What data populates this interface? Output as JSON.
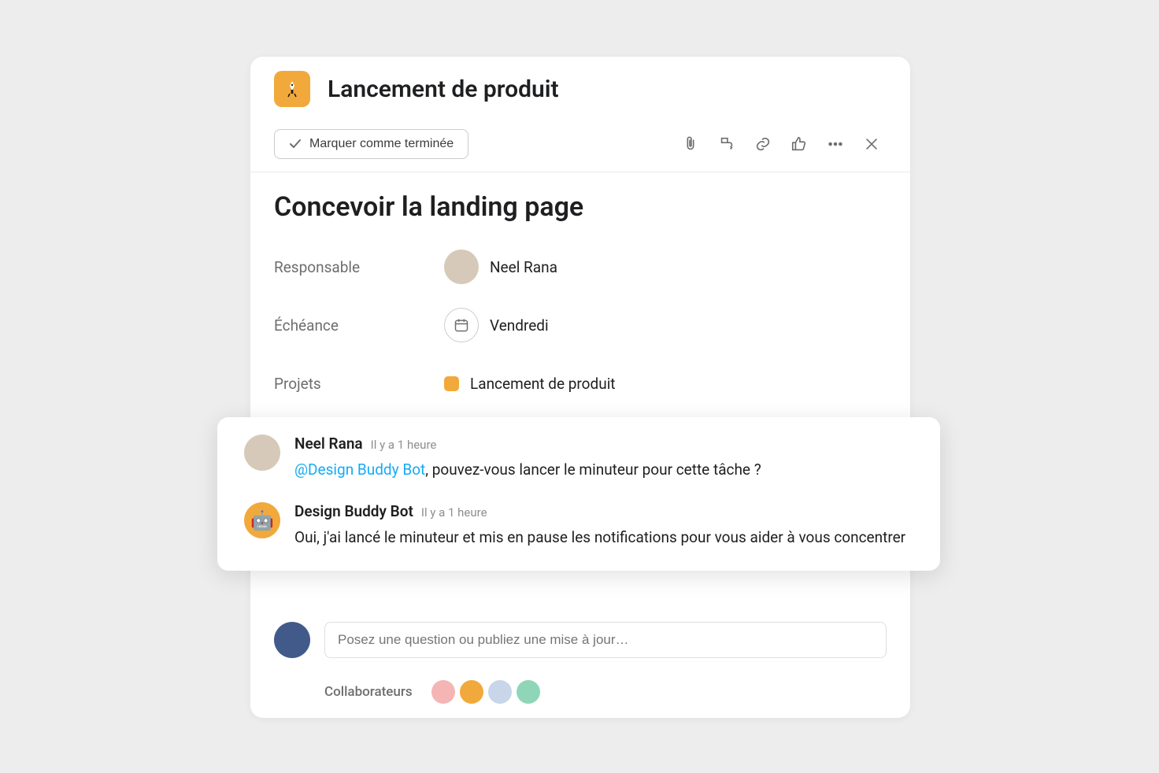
{
  "header": {
    "project_title": "Lancement de produit"
  },
  "toolbar": {
    "complete_label": "Marquer comme terminée"
  },
  "task": {
    "title": "Concevoir la landing page",
    "assignee_label": "Responsable",
    "assignee_name": "Neel Rana",
    "due_label": "Échéance",
    "due_value": "Vendredi",
    "projects_label": "Projets",
    "project_name": "Lancement de produit"
  },
  "comments": [
    {
      "author": "Neel Rana",
      "time": "Il y a 1 heure",
      "mention": "@Design Buddy Bot",
      "text_after_mention": ", pouvez-vous lancer le minuteur pour cette tâche ?"
    },
    {
      "author": "Design Buddy Bot",
      "time": "Il y a 1 heure",
      "text": "Oui, j'ai lancé le minuteur et mis en pause les notifications pour vous aider à vous concentrer"
    }
  ],
  "composer": {
    "placeholder": "Posez une question ou publiez une mise à jour…"
  },
  "collaborators": {
    "label": "Collaborateurs"
  },
  "icons": {
    "attachment": "attachment-icon",
    "subtask": "subtask-icon",
    "link": "link-icon",
    "like": "like-icon",
    "more": "more-icon",
    "close": "close-icon",
    "check": "check-icon",
    "calendar": "calendar-icon",
    "rocket": "rocket-icon",
    "robot": "🤖"
  },
  "colors": {
    "accent": "#f2a93b",
    "link": "#14aaf5",
    "text": "#1e1f21",
    "muted": "#6d6e6f"
  }
}
